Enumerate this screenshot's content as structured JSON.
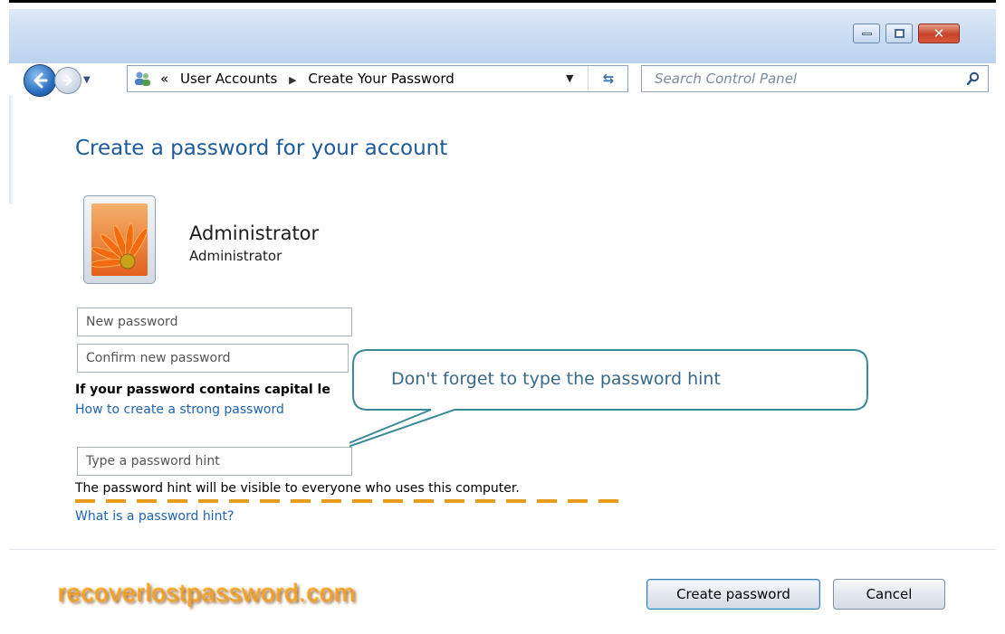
{
  "window": {
    "controls": {
      "minimize": "minimize",
      "maximize": "maximize",
      "close": "close"
    }
  },
  "address_bar": {
    "prefix": "«",
    "breadcrumb": [
      "User Accounts",
      "Create Your Password"
    ]
  },
  "search": {
    "placeholder": "Search Control Panel"
  },
  "page": {
    "heading": "Create a password for your account",
    "user": {
      "name": "Administrator",
      "role": "Administrator"
    },
    "fields": {
      "new_password": {
        "placeholder": "New password",
        "value": ""
      },
      "confirm_password": {
        "placeholder": "Confirm new password",
        "value": ""
      },
      "hint": {
        "placeholder": "Type a password hint",
        "value": ""
      }
    },
    "caps_warning": "If your password contains capital le",
    "link_strong": "How to create a strong password",
    "hint_visible_note": "The password hint will be visible to everyone who uses this computer.",
    "link_hint": "What is a password hint?"
  },
  "callout": {
    "text": "Don't forget to type the password hint"
  },
  "watermark": "recoverlostpassword.com",
  "buttons": {
    "create": "Create password",
    "cancel": "Cancel"
  },
  "colors": {
    "heading": "#1d5a99",
    "link": "#2064b4",
    "callout_border": "#3a8a9a",
    "highlight_underline": "#e99d1e",
    "watermark": "#f1a028"
  }
}
